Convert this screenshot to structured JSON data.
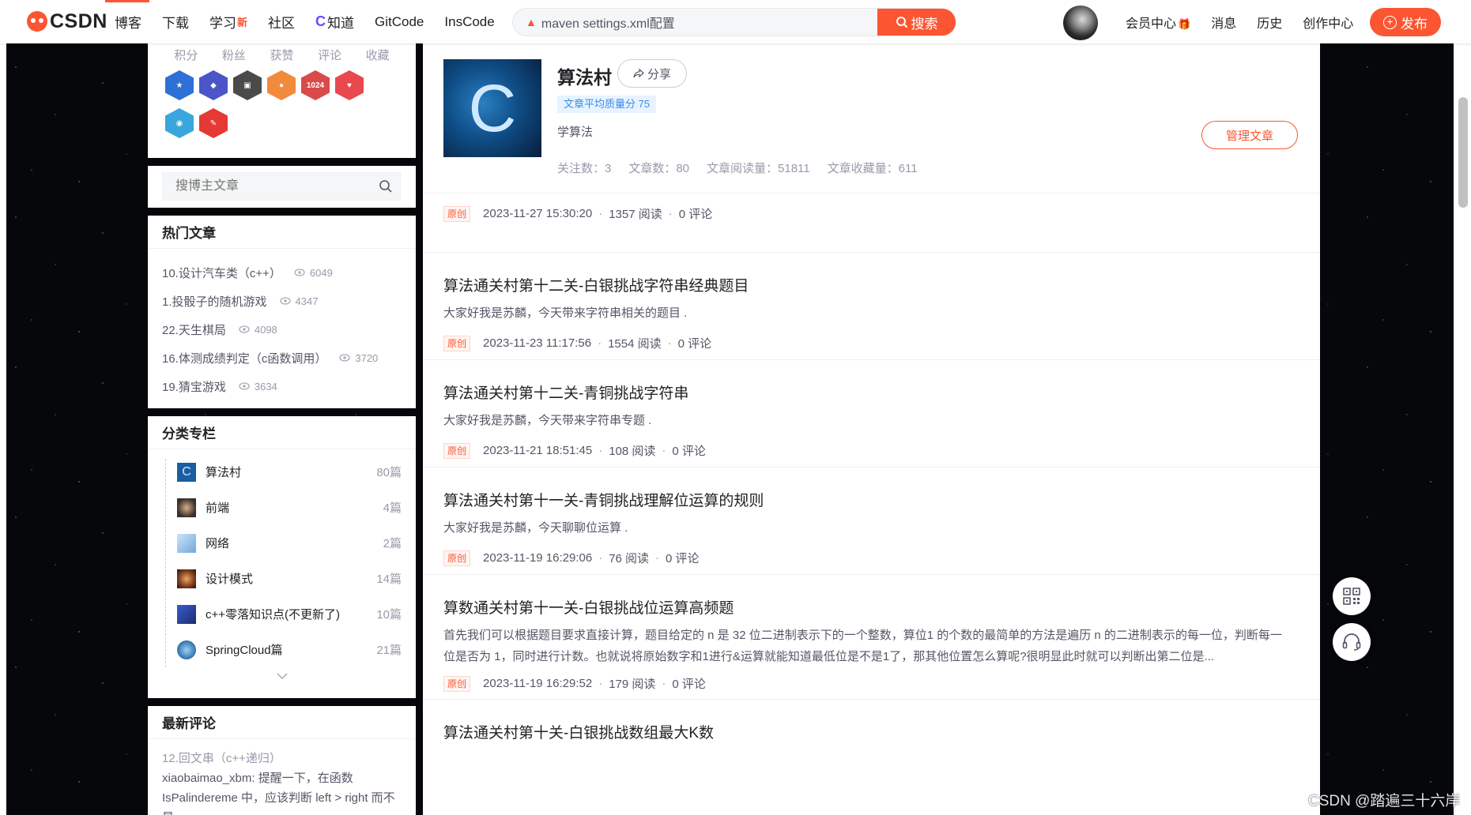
{
  "topbar": {
    "logo_text": "CSDN",
    "nav": [
      {
        "label": "博客"
      },
      {
        "label": "下载"
      },
      {
        "label": "学习",
        "badge": "新"
      },
      {
        "label": "社区"
      },
      {
        "label": "知道",
        "prefix": "C"
      },
      {
        "label": "GitCode"
      },
      {
        "label": "InsCode"
      }
    ],
    "search_value": "maven settings.xml配置",
    "search_button": "搜索",
    "links": [
      {
        "label": "会员中心",
        "icon": "gift-icon"
      },
      {
        "label": "消息"
      },
      {
        "label": "历史"
      },
      {
        "label": "创作中心"
      }
    ],
    "publish_label": "发布",
    "accent_color": "#fc5531"
  },
  "sidebar": {
    "profile_stats": [
      "积分",
      "粉丝",
      "获赞",
      "评论",
      "收藏"
    ],
    "badges": [
      {
        "name": "badge-1",
        "color": "#2e6fd8"
      },
      {
        "name": "badge-2",
        "color": "#4a55c7"
      },
      {
        "name": "badge-3",
        "color": "#4a4a4a"
      },
      {
        "name": "badge-4",
        "color": "#f28a3c"
      },
      {
        "name": "badge-1024",
        "color": "#d94b4b",
        "text": "1024"
      },
      {
        "name": "badge-6",
        "color": "#e9484f"
      },
      {
        "name": "badge-7",
        "color": "#39a7dd"
      },
      {
        "name": "badge-8",
        "color": "#e53935"
      }
    ],
    "search_placeholder": "搜博主文章",
    "hot": {
      "title": "热门文章",
      "items": [
        {
          "title": "10.设计汽车类（c++）",
          "views": "6049"
        },
        {
          "title": "1.投骰子的随机游戏",
          "views": "4347"
        },
        {
          "title": "22.天生棋局",
          "views": "4098"
        },
        {
          "title": "16.体测成绩判定（c函数调用）",
          "views": "3720"
        },
        {
          "title": "19.猜宝游戏",
          "views": "3634"
        }
      ]
    },
    "columns": {
      "title": "分类专栏",
      "items": [
        {
          "name": "算法村",
          "count": "80篇",
          "thumb_color": "#1a5da3"
        },
        {
          "name": "前端",
          "count": "4篇",
          "thumb_color": "#3b2f2a"
        },
        {
          "name": "网络",
          "count": "2篇",
          "thumb_color": "#6fa8dc"
        },
        {
          "name": "设计模式",
          "count": "14篇",
          "thumb_color": "#7a3b1f"
        },
        {
          "name": "c++零落知识点(不更新了)",
          "count": "10篇",
          "thumb_color": "#1d2c6b"
        },
        {
          "name": "SpringCloud篇",
          "count": "21篇",
          "thumb_color": "#3e7fb8"
        }
      ]
    },
    "comments": {
      "title": "最新评论",
      "item_title": "12.回文串（c++递归）",
      "item_text": "xiaobaimao_xbm: 提醒一下，在函数 IsPalindereme 中，应该判断 left > right 而不是..."
    }
  },
  "profile": {
    "thumb_letter": "C",
    "name": "算法村",
    "share": "分享",
    "quality": "文章平均质量分 75",
    "desc": "学算法",
    "stats": [
      "关注数：3",
      "文章数：80",
      "文章阅读量：51811",
      "文章收藏量：611"
    ],
    "manage": "管理文章"
  },
  "articles": [
    {
      "title": "",
      "desc": "",
      "tag": "原创",
      "date": "2023-11-27 15:30:20",
      "reads": "1357 阅读",
      "comments": "0 评论"
    },
    {
      "title": "算法通关村第十二关-白银挑战字符串经典题目",
      "desc": "大家好我是苏麟，今天带来字符串相关的题目 .",
      "tag": "原创",
      "date": "2023-11-23 11:17:56",
      "reads": "1554 阅读",
      "comments": "0 评论"
    },
    {
      "title": "算法通关村第十二关-青铜挑战字符串",
      "desc": "大家好我是苏麟，今天带来字符串专题 .",
      "tag": "原创",
      "date": "2023-11-21 18:51:45",
      "reads": "108 阅读",
      "comments": "0 评论"
    },
    {
      "title": "算法通关村第十一关-青铜挑战理解位运算的规则",
      "desc": "大家好我是苏麟，今天聊聊位运算 .",
      "tag": "原创",
      "date": "2023-11-19 16:29:06",
      "reads": "76 阅读",
      "comments": "0 评论"
    },
    {
      "title": "算数通关村第十一关-白银挑战位运算高频题",
      "desc": "首先我们可以根据题目要求直接计算，题目给定的 n 是 32 位二进制表示下的一个整数，算位1 的个数的最简单的方法是遍历 n 的二进制表示的每一位，判断每一位是否为 1，同时进行计数。也就说将原始数字和1进行&运算就能知道最低位是不是1了，那其他位置怎么算呢?很明显此时就可以判断出第二位是...",
      "tag": "原创",
      "date": "2023-11-19 16:29:52",
      "reads": "179 阅读",
      "comments": "0 评论"
    },
    {
      "title": "算法通关村第十关-白银挑战数组最大K数",
      "desc": "",
      "tag": "",
      "date": "",
      "reads": "",
      "comments": ""
    }
  ],
  "watermark": "CSDN @踏遍三十六岸"
}
